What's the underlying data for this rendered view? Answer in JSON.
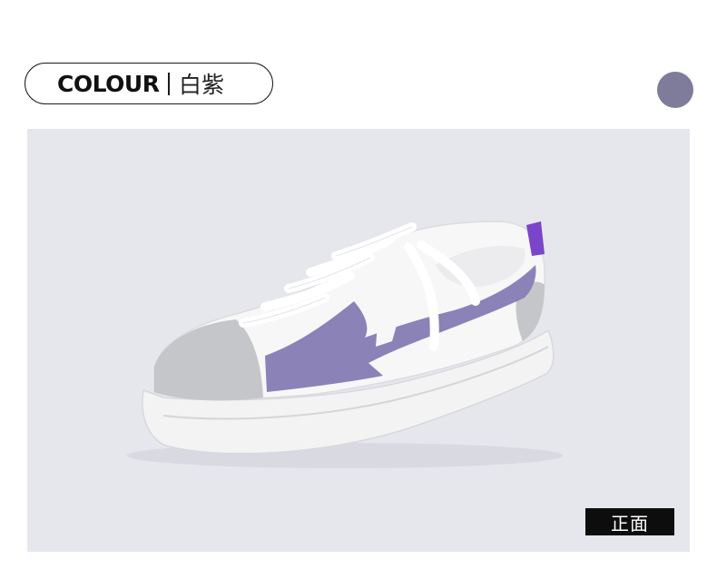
{
  "colour_tag": {
    "label": "COLOUR",
    "name": "白紫"
  },
  "swatch": {
    "color": "#7e7b9b"
  },
  "product_image": {
    "subject": "white-purple-sneaker-icon",
    "colors": {
      "background": "#e6e6ed",
      "upper": "#f7f7f7",
      "sole": "#f3f3f3",
      "suede_grey": "#c5c6c9",
      "accent_purple": "#8b82b8",
      "heel_tab": "#7a45c8",
      "laces": "#ffffff"
    }
  },
  "view_badge": {
    "label": "正面"
  }
}
